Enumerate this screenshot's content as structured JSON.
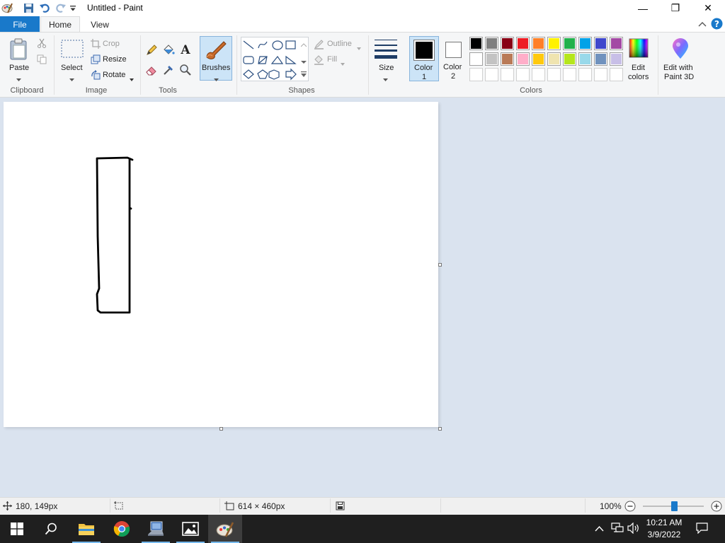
{
  "window": {
    "title": "Untitled - Paint",
    "controls": {
      "minimize": "—",
      "restore": "❐",
      "close": "✕"
    }
  },
  "tabs": {
    "file": "File",
    "home": "Home",
    "view": "View"
  },
  "ribbon": {
    "clipboard": {
      "group": "Clipboard",
      "paste": "Paste"
    },
    "image": {
      "group": "Image",
      "select": "Select",
      "crop": "Crop",
      "resize": "Resize",
      "rotate": "Rotate"
    },
    "tools": {
      "group": "Tools"
    },
    "brushes": {
      "label": "Brushes"
    },
    "shapes": {
      "group": "Shapes",
      "outline": "Outline",
      "fill": "Fill"
    },
    "size": {
      "label": "Size"
    },
    "color1": {
      "label": "Color",
      "num": "1",
      "value": "#000000"
    },
    "color2": {
      "label": "Color",
      "num": "2",
      "value": "#ffffff"
    },
    "colors": {
      "group": "Colors",
      "row1": [
        "#000000",
        "#7f7f7f",
        "#880015",
        "#ed1c24",
        "#ff7f27",
        "#fff200",
        "#22b14c",
        "#00a2e8",
        "#3f48cc",
        "#a349a4"
      ],
      "row2": [
        "#ffffff",
        "#c3c3c3",
        "#b97a57",
        "#ffaec9",
        "#ffc90e",
        "#efe4b0",
        "#b5e61d",
        "#99d9ea",
        "#7092be",
        "#c8bfe7"
      ],
      "row3": [
        "#ffffff",
        "#ffffff",
        "#ffffff",
        "#ffffff",
        "#ffffff",
        "#ffffff",
        "#ffffff",
        "#ffffff",
        "#ffffff",
        "#ffffff"
      ]
    },
    "edit_colors": {
      "line1": "Edit",
      "line2": "colors"
    },
    "paint3d": {
      "line1": "Edit with",
      "line2": "Paint 3D"
    }
  },
  "status": {
    "cursor_pos": "180, 149px",
    "image_size": "614 × 460px",
    "zoom": "100%",
    "zoom_fraction": 0.5
  },
  "taskbar": {
    "time": "10:21 AM",
    "date": "3/9/2022"
  },
  "accent": "#1979ca"
}
